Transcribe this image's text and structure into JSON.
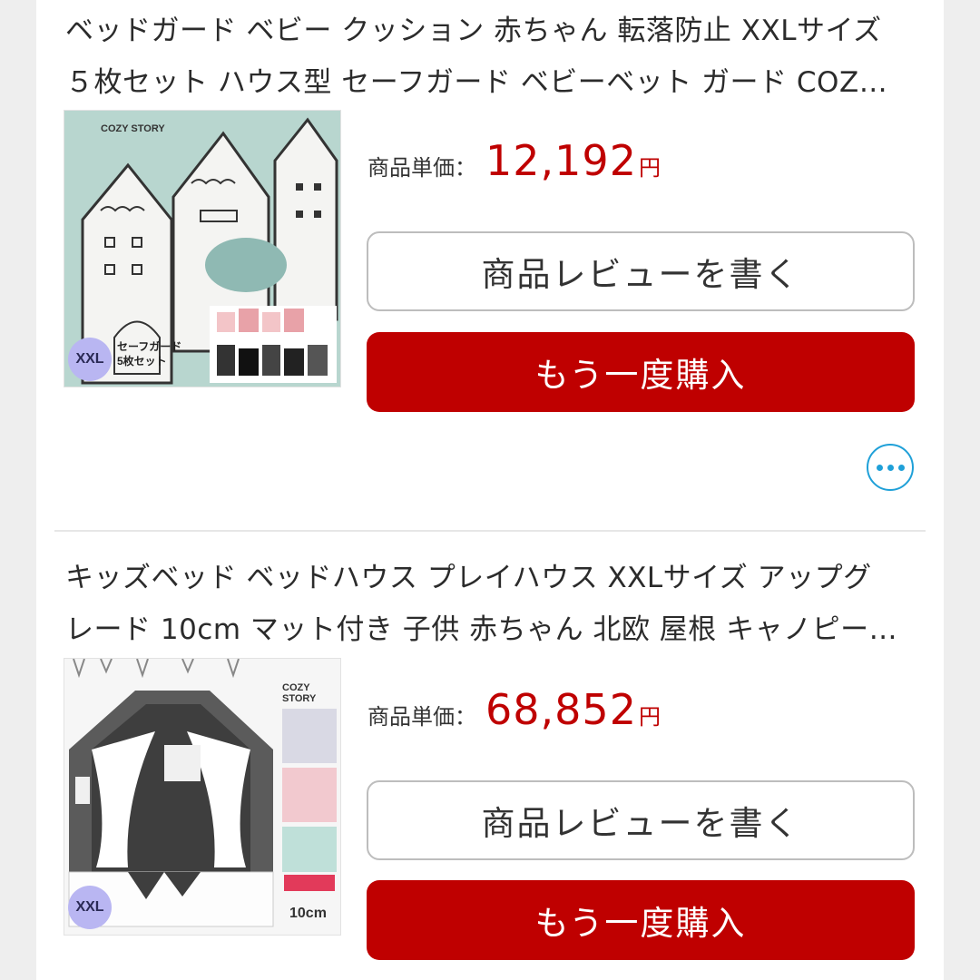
{
  "products": [
    {
      "title_line1": "ベッドガード ベビー クッション 赤ちゃん 転落防止 XXLサイズ",
      "title_line2": "５枚セット ハウス型 セーフガード ベビーベット ガード COZ…",
      "image": {
        "brand": "COZY STORY",
        "badge": "XXL",
        "caption1": "セーフガード",
        "caption2": "5枚セット"
      },
      "price_label": "商品単価：",
      "price": "12,192",
      "price_unit": "円",
      "review_label": "商品レビューを書く",
      "rebuy_label": "もう一度購入"
    },
    {
      "title_line1": "キッズベッド ベッドハウス プレイハウス XXLサイズ アップグ",
      "title_line2": "レード 10cm マット付き 子供 赤ちゃん 北欧 屋根 キャノピー…",
      "image": {
        "brand": "COZY STORY",
        "badge": "XXL",
        "mat_label": "10cm"
      },
      "price_label": "商品単価：",
      "price": "68,852",
      "price_unit": "円",
      "review_label": "商品レビューを書く",
      "rebuy_label": "もう一度購入"
    }
  ],
  "more_button": {
    "icon": "more-dots-icon"
  },
  "colors": {
    "price": "#bf0000",
    "rebuy_bg": "#bf0000",
    "more_accent": "#1fa0d8",
    "thumb1_bg": "#b8d6cf"
  }
}
